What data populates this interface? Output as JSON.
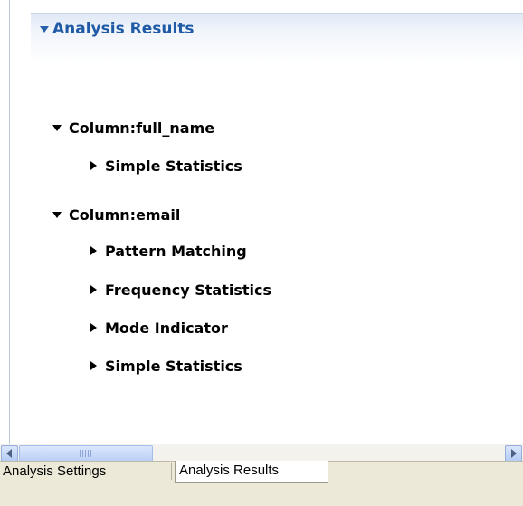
{
  "section": {
    "title": "Analysis Results"
  },
  "tree": {
    "columns": [
      {
        "label": "Column:full_name",
        "items": [
          "Simple Statistics"
        ]
      },
      {
        "label": "Column:email",
        "items": [
          "Pattern Matching",
          "Frequency Statistics",
          "Mode Indicator",
          "Simple Statistics"
        ]
      }
    ]
  },
  "tabs": {
    "settings": "Analysis Settings",
    "results": "Analysis Results",
    "active": "results"
  },
  "colors": {
    "header_text": "#1f5aa6",
    "tab_bar": "#ece9d8"
  }
}
